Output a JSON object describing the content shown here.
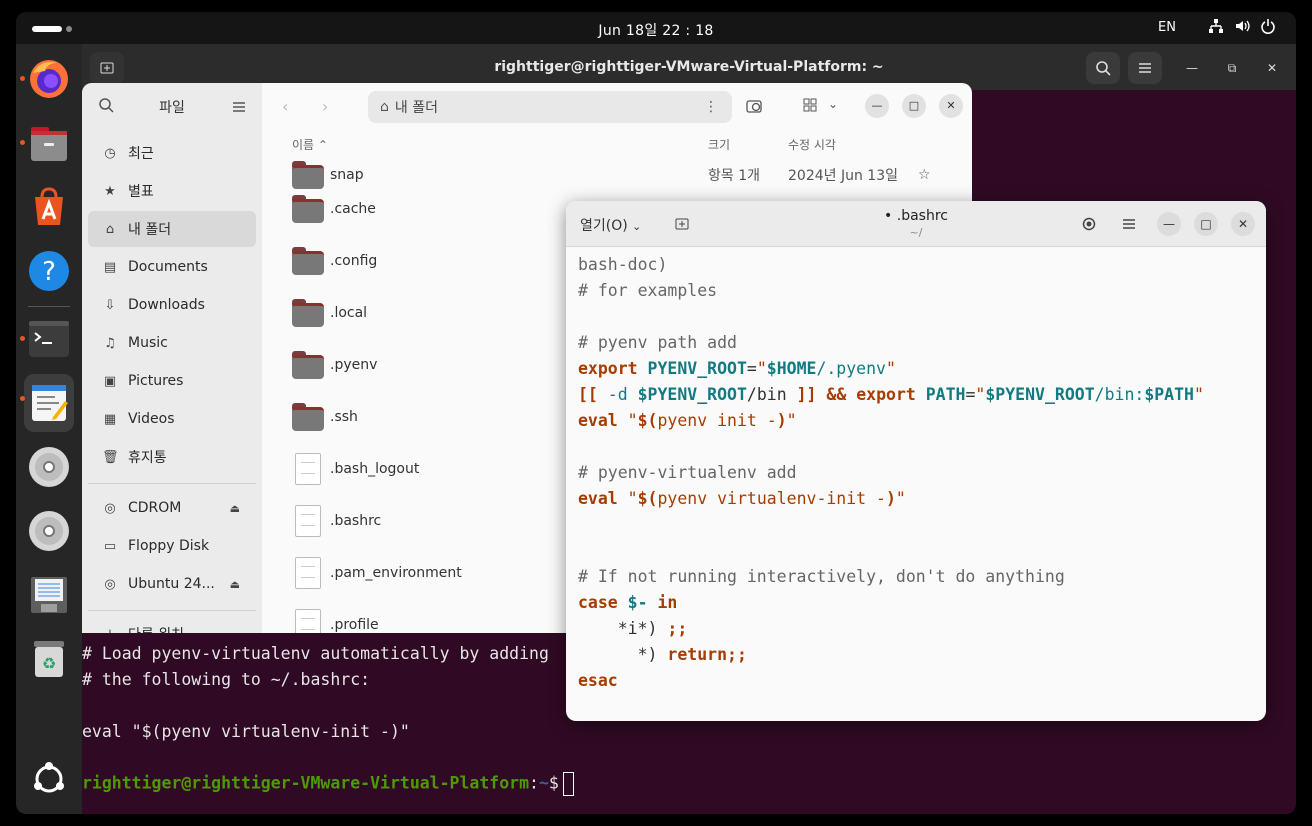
{
  "topbar": {
    "clock": "Jun 18일  22 : 18",
    "lang": "EN"
  },
  "dock": {
    "items": [
      "firefox-icon",
      "files-icon",
      "app-center-icon",
      "help-icon",
      "terminal-icon",
      "text-editor-icon",
      "cdrom-icon",
      "cdrom-icon",
      "floppy-icon",
      "trash-icon",
      "show-apps-icon"
    ]
  },
  "terminal": {
    "title": "righttiger@righttiger-VMware-Virtual-Platform: ~",
    "lines": [
      "# Load pyenv-virtualenv automatically by adding",
      "# the following to ~/.bashrc:",
      "",
      "eval \"$(pyenv virtualenv-init -)\""
    ],
    "prompt_user": "righttiger@righttiger-VMware-Virtual-Platform",
    "prompt_sep": ":",
    "prompt_path": "~",
    "prompt_end": "$"
  },
  "files": {
    "sidebar_title": "파일",
    "places": [
      {
        "label": "최근",
        "icon": "clock-icon"
      },
      {
        "label": "별표",
        "icon": "star-icon"
      },
      {
        "label": "내 폴더",
        "icon": "home-icon"
      },
      {
        "label": "Documents",
        "icon": "document-icon"
      },
      {
        "label": "Downloads",
        "icon": "download-icon"
      },
      {
        "label": "Music",
        "icon": "music-icon"
      },
      {
        "label": "Pictures",
        "icon": "picture-icon"
      },
      {
        "label": "Videos",
        "icon": "video-icon"
      },
      {
        "label": "휴지통",
        "icon": "trash-icon"
      }
    ],
    "devices": [
      {
        "label": "CDROM"
      },
      {
        "label": "Floppy Disk"
      },
      {
        "label": "Ubuntu 24..."
      }
    ],
    "other_locations": "다른 위치",
    "location": "내 폴더",
    "columns": {
      "name": "이름",
      "size": "크기",
      "modified": "수정 시각"
    },
    "partial_row": {
      "name": "snap",
      "size": "항목 1개",
      "modified": "2024년 Jun 13일"
    },
    "rows": [
      {
        "name": ".cache",
        "type": "folder"
      },
      {
        "name": ".config",
        "type": "folder"
      },
      {
        "name": ".local",
        "type": "folder"
      },
      {
        "name": ".pyenv",
        "type": "folder"
      },
      {
        "name": ".ssh",
        "type": "folder"
      },
      {
        "name": ".bash_logout",
        "type": "file"
      },
      {
        "name": ".bashrc",
        "type": "file"
      },
      {
        "name": ".pam_environment",
        "type": "file"
      },
      {
        "name": ".profile",
        "type": "file"
      }
    ]
  },
  "editor": {
    "open_label": "열기(O)",
    "title": "• .bashrc",
    "subtitle": "~/",
    "code": {
      "l1": "bash-doc)",
      "l2": "# for examples",
      "l4": "# pyenv path add",
      "l5_kw": "export",
      "l5_var": "PYENV_ROOT",
      "l5_eq": "=",
      "l5_q1": "\"",
      "l5_home": "$HOME",
      "l5_rest": "/.pyenv",
      "l5_q2": "\"",
      "l6_open": "[[",
      "l6_flag": " -d ",
      "l6_var": "$PYENV_ROOT",
      "l6_bin": "/bin ",
      "l6_close": "]]",
      "l6_and": " && ",
      "l6_kw": "export",
      "l6_var2": " PATH",
      "l6_eq": "=",
      "l6_q1": "\"",
      "l6_var3": "$PYENV_ROOT",
      "l6_mid": "/bin:",
      "l6_var4": "$PATH",
      "l6_q2": "\"",
      "l7_kw": "eval",
      "l7_q1": " \"",
      "l7_sub": "$(",
      "l7_cmd": "pyenv init -",
      "l7_end": ")",
      "l7_q2": "\"",
      "l9": "# pyenv-virtualenv add",
      "l10_kw": "eval",
      "l10_q1": " \"",
      "l10_sub": "$(",
      "l10_cmd": "pyenv virtualenv-init -",
      "l10_end": ")",
      "l10_q2": "\"",
      "l13": "# If not running interactively, don't do anything",
      "l14_kw": "case",
      "l14_var": " $-",
      "l14_in": " in",
      "l15_pat": "    *i*)",
      "l15_end": " ;;",
      "l16_pat": "      *)",
      "l16_ret": " return;;",
      "l17": "esac"
    }
  },
  "colors": {
    "terminal_bg": "#300a24",
    "prompt_user": "#4e9a06",
    "prompt_path": "#3465a4",
    "keyword": "#a63c00",
    "variable": "#137a82",
    "accent": "#e95420"
  }
}
